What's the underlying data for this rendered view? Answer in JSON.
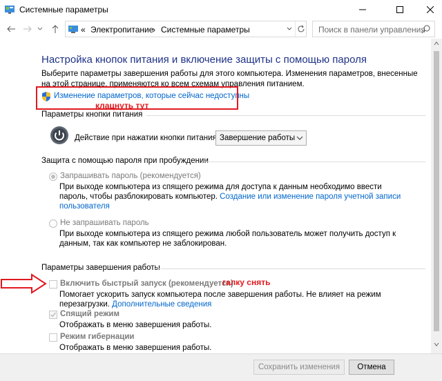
{
  "window": {
    "title": "Системные параметры"
  },
  "address": {
    "prefix": "«",
    "crumb1": "Электропитание",
    "sep": "›",
    "crumb2": "Системные параметры"
  },
  "search": {
    "placeholder": "Поиск в панели управления"
  },
  "main": {
    "heading": "Настройка кнопок питания и включение защиты с помощью пароля",
    "description": "Выберите параметры завершения работы для этого компьютера. Изменения параметров, внесенные на этой странице, применяются ко всем схемам управления питанием.",
    "change_link": "Изменение параметров, которые сейчас недоступны",
    "annotation_click": "клацнуть тут"
  },
  "power_buttons": {
    "group_title": "Параметры кнопки питания",
    "action_label": "Действие при нажатии кнопки питания:",
    "action_value": "Завершение работы"
  },
  "password": {
    "group_title": "Защита с помощью пароля при пробуждении",
    "opt1_label": "Запрашивать пароль (рекомендуется)",
    "opt1_desc_a": "При выходе компьютера из спящего режима для доступа к данным необходимо ввести",
    "opt1_desc_b": "пароль, чтобы разблокировать компьютер.",
    "opt1_link_a": "Создание или изменение пароля учетной записи",
    "opt1_link_b": "пользователя",
    "opt2_label": "Не запрашивать пароль",
    "opt2_desc_a": "При выходе компьютера из спящего режима любой пользователь может получить доступ к",
    "opt2_desc_b": "данным, так как компьютер не заблокирован."
  },
  "shutdown": {
    "group_title": "Параметры завершения работы",
    "fast_label": "Включить быстрый запуск (рекомендуется)",
    "annotation_uncheck": "галку снять",
    "fast_desc_a": "Помогает ускорить запуск компьютера после завершения работы. Не влияет на режим",
    "fast_desc_b": "перезагрузки.",
    "fast_link": "Дополнительные сведения",
    "sleep_label": "Спящий режим",
    "sleep_desc": "Отображать в меню завершения работы.",
    "hibernate_label": "Режим гибернации",
    "hibernate_desc": "Отображать в меню завершения работы."
  },
  "footer": {
    "save_label": "Сохранить изменения",
    "cancel_label": "Отмена"
  },
  "colors": {
    "heading": "#1e3287",
    "link": "#0066cc",
    "annotation": "#e0191f"
  },
  "icons": [
    "control-panel-icon",
    "minimize-icon",
    "maximize-icon",
    "close-icon",
    "back-arrow-icon",
    "forward-arrow-icon",
    "up-arrow-icon",
    "refresh-icon",
    "search-icon",
    "shield-icon",
    "power-icon"
  ]
}
